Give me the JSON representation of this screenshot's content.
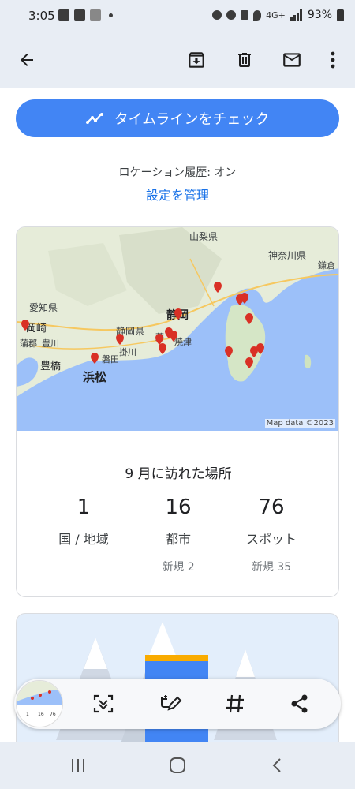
{
  "status_bar": {
    "time": "3:05",
    "network": "4G+",
    "battery": "93%"
  },
  "app_bar": {
    "icons": [
      "back-arrow-icon",
      "archive-icon",
      "trash-icon",
      "mail-icon",
      "more-vert-icon"
    ]
  },
  "content": {
    "timeline_button_label": "タイムラインをチェック",
    "location_history": "ロケーション履歴: オン",
    "manage_settings": "設定を管理",
    "map": {
      "attribution": "Map data ©2023",
      "place_labels": [
        "山梨県",
        "神奈川県",
        "鎌倉",
        "愛知県",
        "岡崎",
        "蒲郡",
        "豊川",
        "静岡県",
        "静岡",
        "焼津",
        "掛川",
        "磐田",
        "豊橋",
        "浜松",
        "藤"
      ],
      "pin_color": "#d93025"
    },
    "visited_title": "9 月に訪れた場所",
    "stats": [
      {
        "value": "1",
        "label": "国 / 地域",
        "new": ""
      },
      {
        "value": "16",
        "label": "都市",
        "new": "新規 2"
      },
      {
        "value": "76",
        "label": "スポット",
        "new": "新規 35"
      }
    ]
  },
  "thumbnail_stats": [
    "1",
    "16",
    "76"
  ],
  "floating_toolbar": {
    "icons": [
      "scan-text-icon",
      "edit-image-icon",
      "hashtag-icon",
      "share-icon"
    ]
  },
  "nav_bar": {
    "icons": [
      "recents-icon",
      "home-icon",
      "back-chevron-icon"
    ]
  },
  "colors": {
    "accent": "#4285f4",
    "link": "#1a73e8",
    "sea": "#9cc0f9",
    "land": "#e6ecd9"
  }
}
